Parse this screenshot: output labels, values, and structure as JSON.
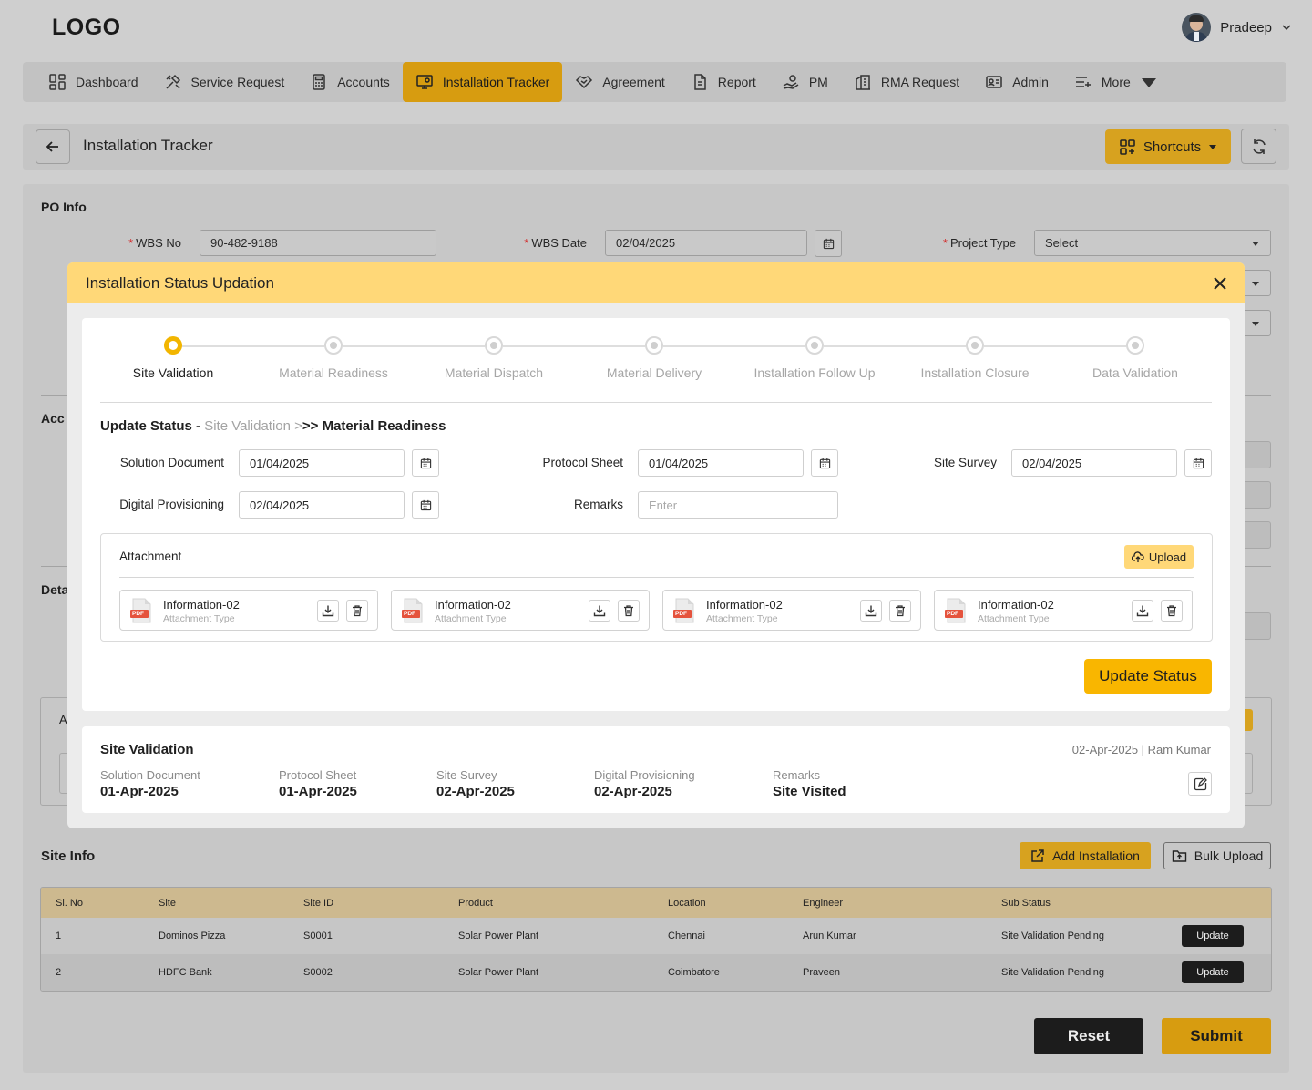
{
  "header": {
    "logo": "LOGO",
    "user_name": "Pradeep"
  },
  "nav": [
    {
      "label": "Dashboard",
      "icon": "dashboard-icon"
    },
    {
      "label": "Service Request",
      "icon": "tools-icon"
    },
    {
      "label": "Accounts",
      "icon": "calculator-icon"
    },
    {
      "label": "Installation Tracker",
      "icon": "monitor-settings-icon",
      "active": true
    },
    {
      "label": "Agreement",
      "icon": "handshake-icon"
    },
    {
      "label": "Report",
      "icon": "document-icon"
    },
    {
      "label": "PM",
      "icon": "hand-gear-icon"
    },
    {
      "label": "RMA Request",
      "icon": "building-icon"
    },
    {
      "label": "Admin",
      "icon": "id-card-icon"
    },
    {
      "label": "More",
      "icon": "list-add-icon"
    }
  ],
  "page": {
    "title": "Installation Tracker",
    "shortcuts": "Shortcuts"
  },
  "po_info": {
    "title": "PO Info",
    "wbs_no_label": "WBS No",
    "wbs_no": "90-482-9188",
    "wbs_date_label": "WBS Date",
    "wbs_date": "02/04/2025",
    "project_type_label": "Project Type",
    "project_type": "Select"
  },
  "bg_sections": {
    "acc": "Acc",
    "det": "Deta",
    "a": "A"
  },
  "site_info": {
    "title": "Site Info",
    "add_installation": "Add Installation",
    "bulk_upload": "Bulk Upload",
    "columns": [
      "Sl. No",
      "Site",
      "Site ID",
      "Product",
      "Location",
      "Engineer",
      "Sub Status"
    ],
    "rows": [
      [
        "1",
        "Dominos Pizza",
        "S0001",
        "Solar Power Plant",
        "Chennai",
        "Arun Kumar",
        "Site Validation Pending"
      ],
      [
        "2",
        "HDFC Bank",
        "S0002",
        "Solar Power Plant",
        "Coimbatore",
        "Praveen",
        "Site Validation Pending"
      ]
    ],
    "update_label": "Update"
  },
  "footer": {
    "reset": "Reset",
    "submit": "Submit"
  },
  "modal": {
    "title": "Installation Status Updation",
    "steps": [
      "Site Validation",
      "Material Readiness",
      "Material Dispatch",
      "Material Delivery",
      "Installation Follow Up",
      "Installation Closure",
      "Data Validation"
    ],
    "active_step": 0,
    "update_status_prefix": "Update Status - ",
    "update_status_from": "Site Validation >",
    "update_status_to": ">> Material Readiness",
    "fields": {
      "solution_document_label": "Solution Document",
      "solution_document": "01/04/2025",
      "protocol_sheet_label": "Protocol Sheet",
      "protocol_sheet": "01/04/2025",
      "site_survey_label": "Site Survey",
      "site_survey": "02/04/2025",
      "digital_provisioning_label": "Digital Provisioning",
      "digital_provisioning": "02/04/2025",
      "remarks_label": "Remarks",
      "remarks_placeholder": "Enter"
    },
    "attachment": {
      "title": "Attachment",
      "upload": "Upload",
      "files": [
        {
          "name": "Information-02",
          "type": "Attachment Type",
          "badge": "PDF"
        },
        {
          "name": "Information-02",
          "type": "Attachment Type",
          "badge": "PDF"
        },
        {
          "name": "Information-02",
          "type": "Attachment Type",
          "badge": "PDF"
        },
        {
          "name": "Information-02",
          "type": "Attachment Type",
          "badge": "PDF"
        }
      ]
    },
    "update_button": "Update Status",
    "history": {
      "title": "Site Validation",
      "meta": "02-Apr-2025  |  Ram Kumar",
      "items": [
        {
          "label": "Solution Document",
          "value": "01-Apr-2025"
        },
        {
          "label": "Protocol Sheet",
          "value": "01-Apr-2025"
        },
        {
          "label": "Site Survey",
          "value": "02-Apr-2025"
        },
        {
          "label": "Digital Provisioning",
          "value": "02-Apr-2025"
        },
        {
          "label": "Remarks",
          "value": "Site Visited"
        }
      ]
    }
  }
}
